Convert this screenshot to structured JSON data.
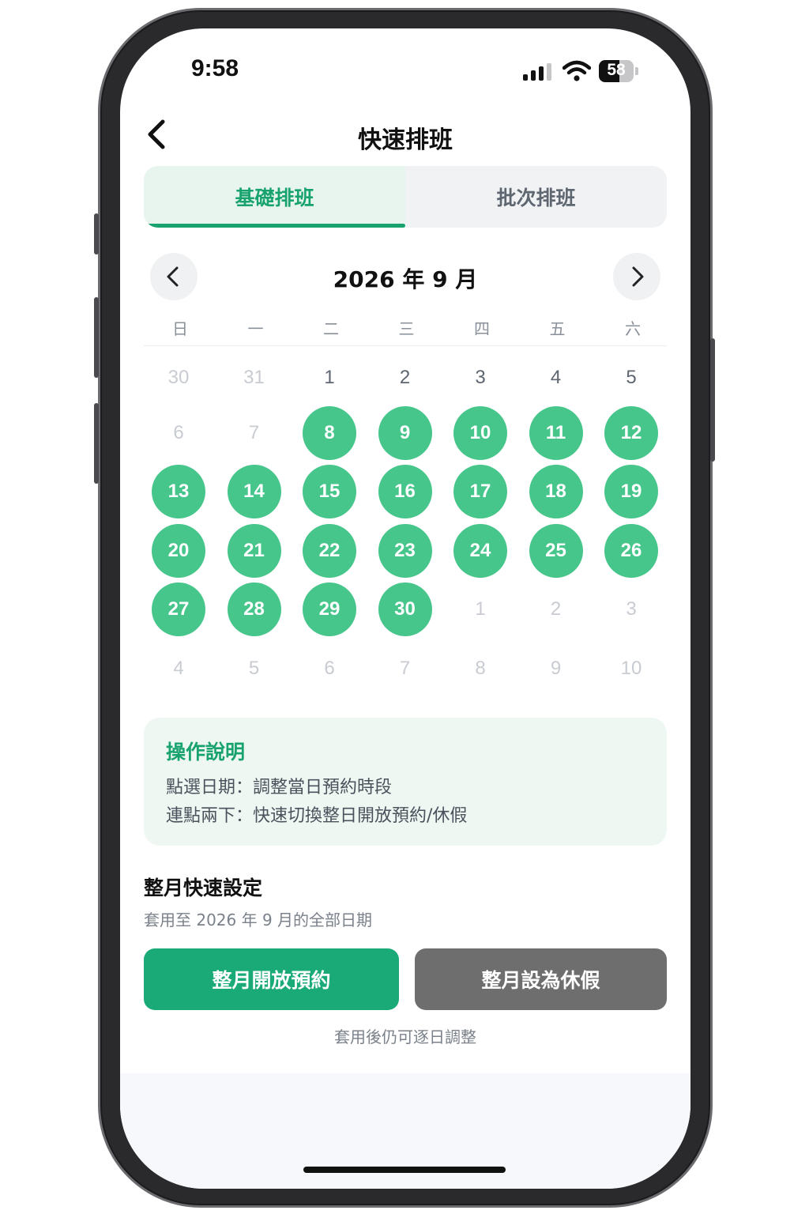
{
  "status_bar": {
    "time": "9:58",
    "battery": "58"
  },
  "header": {
    "title": "快速排班"
  },
  "tabs": [
    {
      "label": "基礎排班",
      "active": true
    },
    {
      "label": "批次排班",
      "active": false
    }
  ],
  "calendar": {
    "month_label": "2026 年 9 月",
    "weekdays": [
      "日",
      "一",
      "二",
      "三",
      "四",
      "五",
      "六"
    ],
    "weeks": [
      [
        {
          "d": "30",
          "s": "out"
        },
        {
          "d": "31",
          "s": "out"
        },
        {
          "d": "1",
          "s": "norm"
        },
        {
          "d": "2",
          "s": "norm"
        },
        {
          "d": "3",
          "s": "norm"
        },
        {
          "d": "4",
          "s": "norm"
        },
        {
          "d": "5",
          "s": "norm"
        }
      ],
      [
        {
          "d": "6",
          "s": "out"
        },
        {
          "d": "7",
          "s": "out"
        },
        {
          "d": "8",
          "s": "open"
        },
        {
          "d": "9",
          "s": "open"
        },
        {
          "d": "10",
          "s": "open"
        },
        {
          "d": "11",
          "s": "open"
        },
        {
          "d": "12",
          "s": "open"
        }
      ],
      [
        {
          "d": "13",
          "s": "open"
        },
        {
          "d": "14",
          "s": "open"
        },
        {
          "d": "15",
          "s": "open"
        },
        {
          "d": "16",
          "s": "open"
        },
        {
          "d": "17",
          "s": "open"
        },
        {
          "d": "18",
          "s": "open"
        },
        {
          "d": "19",
          "s": "open"
        }
      ],
      [
        {
          "d": "20",
          "s": "open"
        },
        {
          "d": "21",
          "s": "open"
        },
        {
          "d": "22",
          "s": "open"
        },
        {
          "d": "23",
          "s": "open"
        },
        {
          "d": "24",
          "s": "open"
        },
        {
          "d": "25",
          "s": "open"
        },
        {
          "d": "26",
          "s": "open"
        }
      ],
      [
        {
          "d": "27",
          "s": "open"
        },
        {
          "d": "28",
          "s": "open"
        },
        {
          "d": "29",
          "s": "open"
        },
        {
          "d": "30",
          "s": "open"
        },
        {
          "d": "1",
          "s": "out"
        },
        {
          "d": "2",
          "s": "out"
        },
        {
          "d": "3",
          "s": "out"
        }
      ],
      [
        {
          "d": "4",
          "s": "out"
        },
        {
          "d": "5",
          "s": "out"
        },
        {
          "d": "6",
          "s": "out"
        },
        {
          "d": "7",
          "s": "out"
        },
        {
          "d": "8",
          "s": "out"
        },
        {
          "d": "9",
          "s": "out"
        },
        {
          "d": "10",
          "s": "out"
        }
      ]
    ]
  },
  "guide": {
    "title": "操作說明",
    "lines": [
      "點選日期：調整當日預約時段",
      "連點兩下：快速切換整日開放預約/休假"
    ]
  },
  "monthly": {
    "title": "整月快速設定",
    "subtitle": "套用至 2026 年 9 月的全部日期",
    "open_label": "整月開放預約",
    "off_label": "整月設為休假",
    "footnote": "套用後仍可逐日調整"
  },
  "colors": {
    "accent": "#18a36e",
    "open_day": "#47c68c",
    "off_button": "#6e6e6e"
  },
  "icons": [
    "back-chevron-icon",
    "prev-month-icon",
    "next-month-icon",
    "signal-icon",
    "wifi-icon",
    "battery-icon"
  ]
}
